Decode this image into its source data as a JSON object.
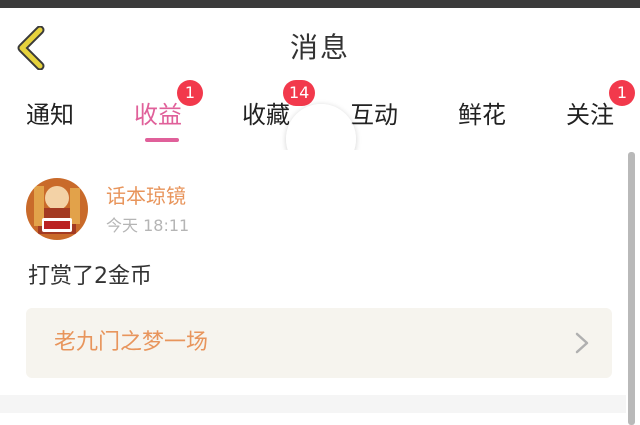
{
  "header": {
    "title": "消息",
    "back_icon": "chevron-left-icon",
    "back_color": "#e6d23c"
  },
  "tabs": [
    {
      "label": "通知",
      "badge": "",
      "active": false
    },
    {
      "label": "收益",
      "badge": "1",
      "active": true
    },
    {
      "label": "收藏",
      "badge": "14",
      "active": false
    },
    {
      "label": "互动",
      "badge": "",
      "active": false
    },
    {
      "label": "鲜花",
      "badge": "",
      "active": false
    },
    {
      "label": "关注",
      "badge": "1",
      "active": false
    }
  ],
  "message": {
    "author": "话本琼镜",
    "time": "今天 18:11",
    "text": "打赏了2金币",
    "book_title": "老九门之梦一场",
    "link_icon": "chevron-right-icon"
  },
  "colors": {
    "accent": "#e0609a",
    "badge": "#f2394c",
    "author": "#e8955c"
  }
}
